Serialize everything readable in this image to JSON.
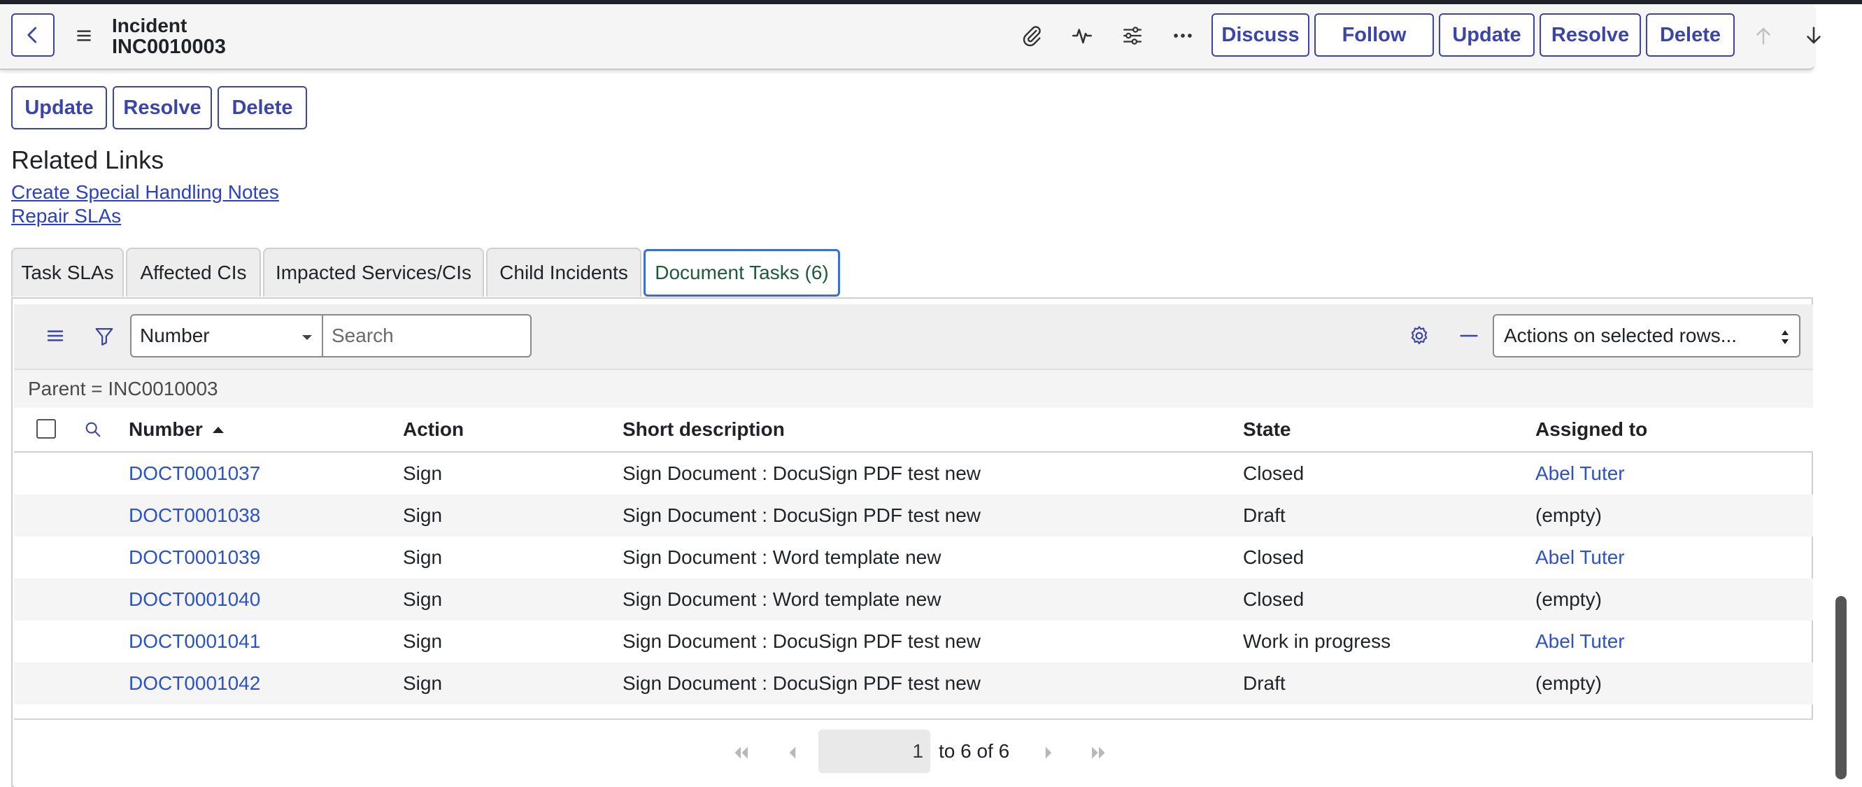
{
  "header": {
    "title": "Incident",
    "record_number": "INC0010003",
    "buttons": [
      "Discuss",
      "Follow",
      "Update",
      "Resolve",
      "Delete"
    ]
  },
  "form_actions": [
    "Update",
    "Resolve",
    "Delete"
  ],
  "related_links": {
    "heading": "Related Links",
    "links": [
      "Create Special Handling Notes",
      "Repair SLAs"
    ]
  },
  "tabs": [
    {
      "label": "Task SLAs"
    },
    {
      "label": "Affected CIs"
    },
    {
      "label": "Impacted Services/CIs"
    },
    {
      "label": "Child Incidents"
    },
    {
      "label": "Document Tasks (6)",
      "active": true
    }
  ],
  "list": {
    "search_field": "Number",
    "search_placeholder": "Search",
    "actions_label": "Actions on selected rows...",
    "filter": "Parent = INC0010003",
    "columns": [
      "Number",
      "Action",
      "Short description",
      "State",
      "Assigned to"
    ],
    "sort_column": "Number",
    "rows": [
      {
        "number": "DOCT0001037",
        "action": "Sign",
        "short_description": "Sign Document : DocuSign PDF test new",
        "state": "Closed",
        "assigned_to": "Abel Tuter"
      },
      {
        "number": "DOCT0001038",
        "action": "Sign",
        "short_description": "Sign Document : DocuSign PDF test new",
        "state": "Draft",
        "assigned_to": "(empty)"
      },
      {
        "number": "DOCT0001039",
        "action": "Sign",
        "short_description": "Sign Document : Word template new",
        "state": "Closed",
        "assigned_to": "Abel Tuter"
      },
      {
        "number": "DOCT0001040",
        "action": "Sign",
        "short_description": "Sign Document : Word template new",
        "state": "Closed",
        "assigned_to": "(empty)"
      },
      {
        "number": "DOCT0001041",
        "action": "Sign",
        "short_description": "Sign Document : DocuSign PDF test new",
        "state": "Work in progress",
        "assigned_to": "Abel Tuter"
      },
      {
        "number": "DOCT0001042",
        "action": "Sign",
        "short_description": "Sign Document : DocuSign PDF test new",
        "state": "Draft",
        "assigned_to": "(empty)"
      }
    ],
    "pagination": {
      "current_page": "1",
      "range_text": "to 6 of 6"
    }
  },
  "colors": {
    "accent": "#3b45a8",
    "link": "#2c40c4",
    "active_tab_border": "#3b6fd4"
  },
  "icons": [
    "back-icon",
    "hamburger-menu-icon",
    "paperclip-icon",
    "activity-icon",
    "settings-sliders-icon",
    "more-icon",
    "arrow-up-icon",
    "arrow-down-icon",
    "filter-icon",
    "search-icon",
    "gear-icon",
    "collapse-icon",
    "first-page-icon",
    "previous-page-icon",
    "next-page-icon",
    "last-page-icon"
  ]
}
